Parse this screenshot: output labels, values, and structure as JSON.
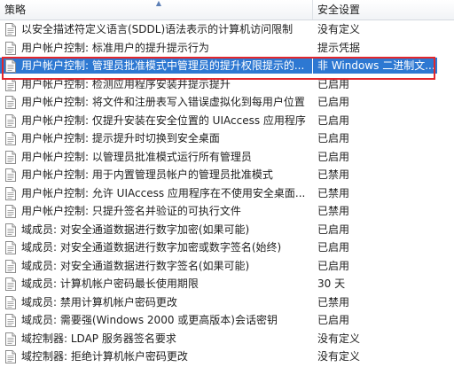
{
  "header": {
    "policy_label": "策略",
    "setting_label": "安全设置"
  },
  "icons": {
    "policy_icon": "policy-document-icon",
    "sort_icon": "sort-ascending-icon"
  },
  "colors": {
    "selection": "#2d78d2",
    "outline": "#e3262c"
  },
  "selected_row_index": 2,
  "rows": [
    {
      "policy": "以安全描述符定义语言(SDDL)语法表示的计算机访问限制",
      "setting": "没有定义"
    },
    {
      "policy": "用户帐户控制: 标准用户的提升提示行为",
      "setting": "提示凭据"
    },
    {
      "policy": "用户帐户控制: 管理员批准模式中管理员的提升权限提示的...",
      "setting": "非 Windows 二进制文..."
    },
    {
      "policy": "用户帐户控制: 检测应用程序安装并提示提升",
      "setting": "已启用"
    },
    {
      "policy": "用户帐户控制: 将文件和注册表写入错误虚拟化到每用户位置",
      "setting": "已启用"
    },
    {
      "policy": "用户帐户控制: 仅提升安装在安全位置的 UIAccess 应用程序",
      "setting": "已启用"
    },
    {
      "policy": "用户帐户控制: 提示提升时切换到安全桌面",
      "setting": "已启用"
    },
    {
      "policy": "用户帐户控制: 以管理员批准模式运行所有管理员",
      "setting": "已启用"
    },
    {
      "policy": "用户帐户控制: 用于内置管理员帐户的管理员批准模式",
      "setting": "已禁用"
    },
    {
      "policy": "用户帐户控制: 允许 UIAccess 应用程序在不使用安全桌面...",
      "setting": "已禁用"
    },
    {
      "policy": "用户帐户控制: 只提升签名并验证的可执行文件",
      "setting": "已禁用"
    },
    {
      "policy": "域成员: 对安全通道数据进行数字加密(如果可能)",
      "setting": "已启用"
    },
    {
      "policy": "域成员: 对安全通道数据进行数字加密或数字签名(始终)",
      "setting": "已启用"
    },
    {
      "policy": "域成员: 对安全通道数据进行数字签名(如果可能)",
      "setting": "已启用"
    },
    {
      "policy": "域成员: 计算机帐户密码最长使用期限",
      "setting": "30 天"
    },
    {
      "policy": "域成员: 禁用计算机帐户密码更改",
      "setting": "已禁用"
    },
    {
      "policy": "域成员: 需要强(Windows 2000 或更高版本)会话密钥",
      "setting": "已启用"
    },
    {
      "policy": "域控制器: LDAP 服务器签名要求",
      "setting": "没有定义"
    },
    {
      "policy": "域控制器: 拒绝计算机帐户密码更改",
      "setting": "没有定义"
    }
  ]
}
